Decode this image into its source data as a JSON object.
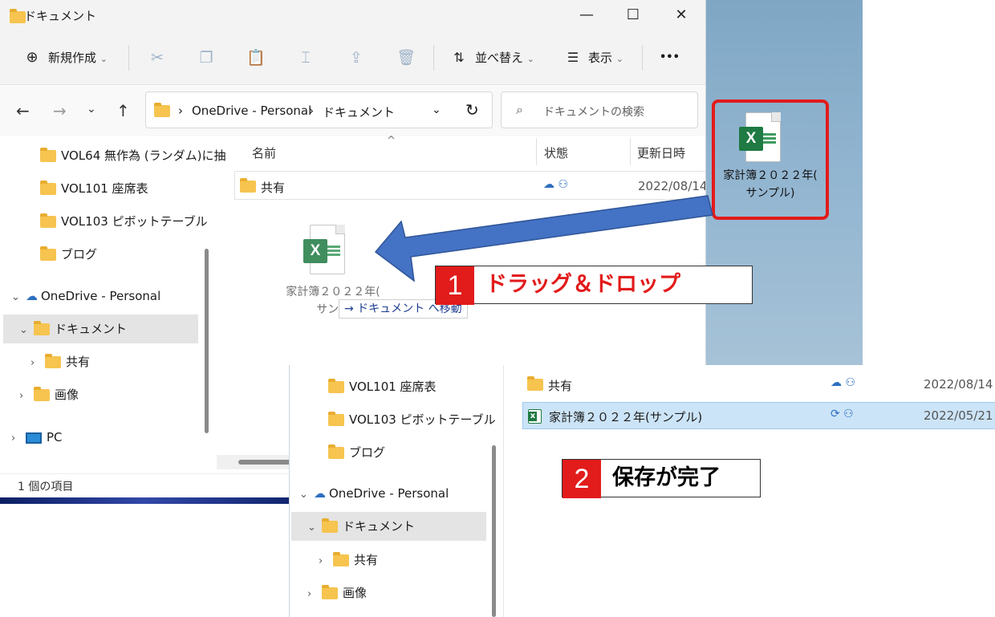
{
  "window1": {
    "title": "ドキュメント",
    "controls": {
      "minimize": "—",
      "maximize": "☐",
      "close": "✕"
    },
    "toolbar": {
      "new_label": "新規作成",
      "sort_label": "並べ替え",
      "view_label": "表示",
      "more_label": "•••",
      "chev": "⌄"
    },
    "nav": {
      "back": "←",
      "forward": "→",
      "recent": "⌄",
      "up": "↑",
      "dropdown": "⌄",
      "refresh": "↻"
    },
    "address": {
      "sep": "›",
      "segments": [
        "OneDrive - Personal",
        "ドキュメント"
      ]
    },
    "search": {
      "placeholder": "ドキュメントの検索"
    },
    "nav_pane": {
      "items": [
        "VOL64 無作為 (ランダム)に抽",
        "VOL101 座席表",
        "VOL103 ピボットテーブル",
        "ブログ",
        "OneDrive - Personal",
        "ドキュメント",
        "共有",
        "画像",
        "PC"
      ]
    },
    "columns": {
      "name": "名前",
      "status": "状態",
      "modified": "更新日時",
      "sort_arrow": "^"
    },
    "rows": [
      {
        "name": "共有",
        "status": "☁ ⚇",
        "date": "2022/08/14"
      }
    ],
    "drag": {
      "file_line1": "家計簿２０２２年(",
      "file_line2": "サンブ",
      "tooltip": "→ ドキュメント へ移動"
    },
    "status_text": "1 個の項目"
  },
  "desktop_icon": {
    "label_line1": "家計簿２０２２年(",
    "label_line2": "サンプル)",
    "badge": "X"
  },
  "steps": [
    {
      "number": "1",
      "text": "ドラッグ＆ドロップ"
    },
    {
      "number": "2",
      "text": "保存が完了"
    }
  ],
  "window2": {
    "nav_pane": {
      "items": [
        "VOL101 座席表",
        "VOL103 ピボットテーブル",
        "ブログ",
        "OneDrive - Personal",
        "ドキュメント",
        "共有",
        "画像"
      ]
    },
    "rows": [
      {
        "name": "共有",
        "status": "☁ ⚇",
        "date": "2022/08/14"
      },
      {
        "name": "家計簿２０２２年(サンプル)",
        "status": "⟳ ⚇",
        "date": "2022/05/21"
      }
    ]
  },
  "colors": {
    "highlight_red": "#e21b1b",
    "arrow_blue": "#4472c4",
    "selection_blue": "#cce4f7"
  }
}
